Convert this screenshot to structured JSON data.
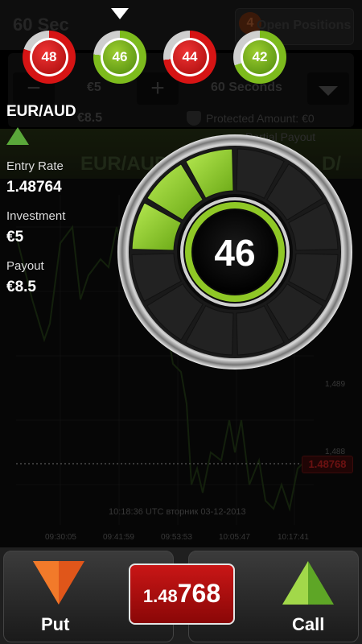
{
  "header": {
    "title": "60 Sec",
    "open_positions_label": "Open Positions",
    "open_positions_count": "4"
  },
  "timers": [
    {
      "value": "48",
      "color": "#d61414"
    },
    {
      "value": "46",
      "color": "#7dbb1d"
    },
    {
      "value": "44",
      "color": "#d61414"
    },
    {
      "value": "42",
      "color": "#7dbb1d"
    }
  ],
  "controls": {
    "amount": "€5",
    "minus_label": "−",
    "plus_label": "+",
    "expiry": "60 Seconds",
    "payout_small": "€8.5",
    "protected_amount": "Protected Amount: €0",
    "partial_payout": "Partial Payout"
  },
  "asset": {
    "pair": "EUR/AUD",
    "entry_rate_label": "Entry Rate",
    "entry_rate": "1.48764",
    "investment_label": "Investment",
    "investment": "€5",
    "payout_label": "Payout",
    "payout": "€8.5"
  },
  "dial": {
    "value": "46",
    "progress": 0.77
  },
  "chart": {
    "ticker_left": "EUR/AUD",
    "ticker_right": "D/",
    "y_labels": [
      "1,489",
      "1,488"
    ],
    "current_price_tag": "1.48768",
    "timestamp": "10:18:36  UTC вторник  03-12-2013",
    "x_labels": [
      "09:30:05",
      "09:41:59",
      "09:53:53",
      "10:05:47",
      "10:17:41"
    ]
  },
  "actions": {
    "put_label": "Put",
    "call_label": "Call",
    "price_prefix": "1.48",
    "price_suffix": "768"
  }
}
